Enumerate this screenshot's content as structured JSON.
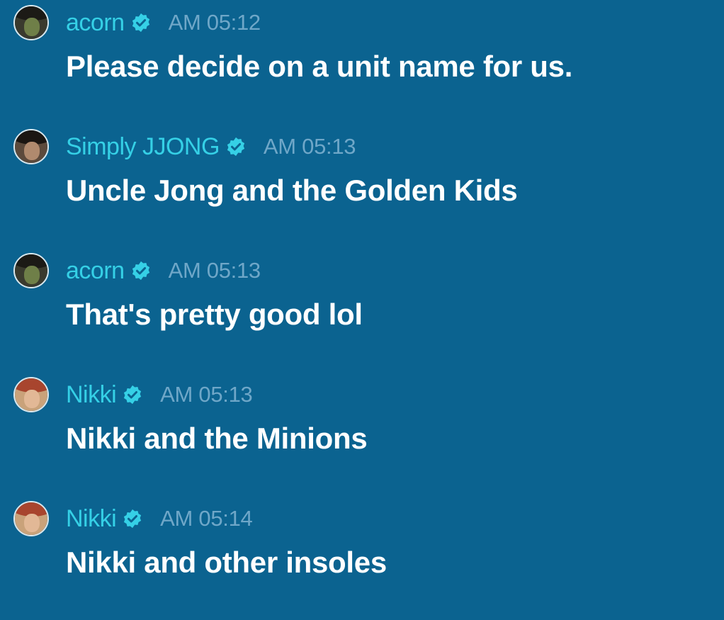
{
  "messages": [
    {
      "username": "acorn",
      "time": "AM 05:12",
      "text": "Please decide on a unit name for us.",
      "avatar": "acorn-avatar",
      "verified": true
    },
    {
      "username": "Simply JJONG",
      "time": "AM 05:13",
      "text": "Uncle Jong and the Golden Kids",
      "avatar": "simply-jjong-avatar",
      "verified": true
    },
    {
      "username": "acorn",
      "time": "AM 05:13",
      "text": "That's pretty good lol",
      "avatar": "acorn-avatar",
      "verified": true
    },
    {
      "username": "Nikki",
      "time": "AM 05:13",
      "text": "Nikki and the Minions",
      "avatar": "nikki-avatar",
      "verified": true
    },
    {
      "username": "Nikki",
      "time": "AM 05:14",
      "text": "Nikki and other insoles",
      "avatar": "nikki-avatar",
      "verified": true
    }
  ],
  "colors": {
    "background": "#0b6390",
    "username": "#35d0e6",
    "timestamp": "#6fa7c8",
    "message_text": "#ffffff",
    "verified_badge": "#35d0e6"
  },
  "icons": {
    "verified": "verified-badge-icon"
  }
}
